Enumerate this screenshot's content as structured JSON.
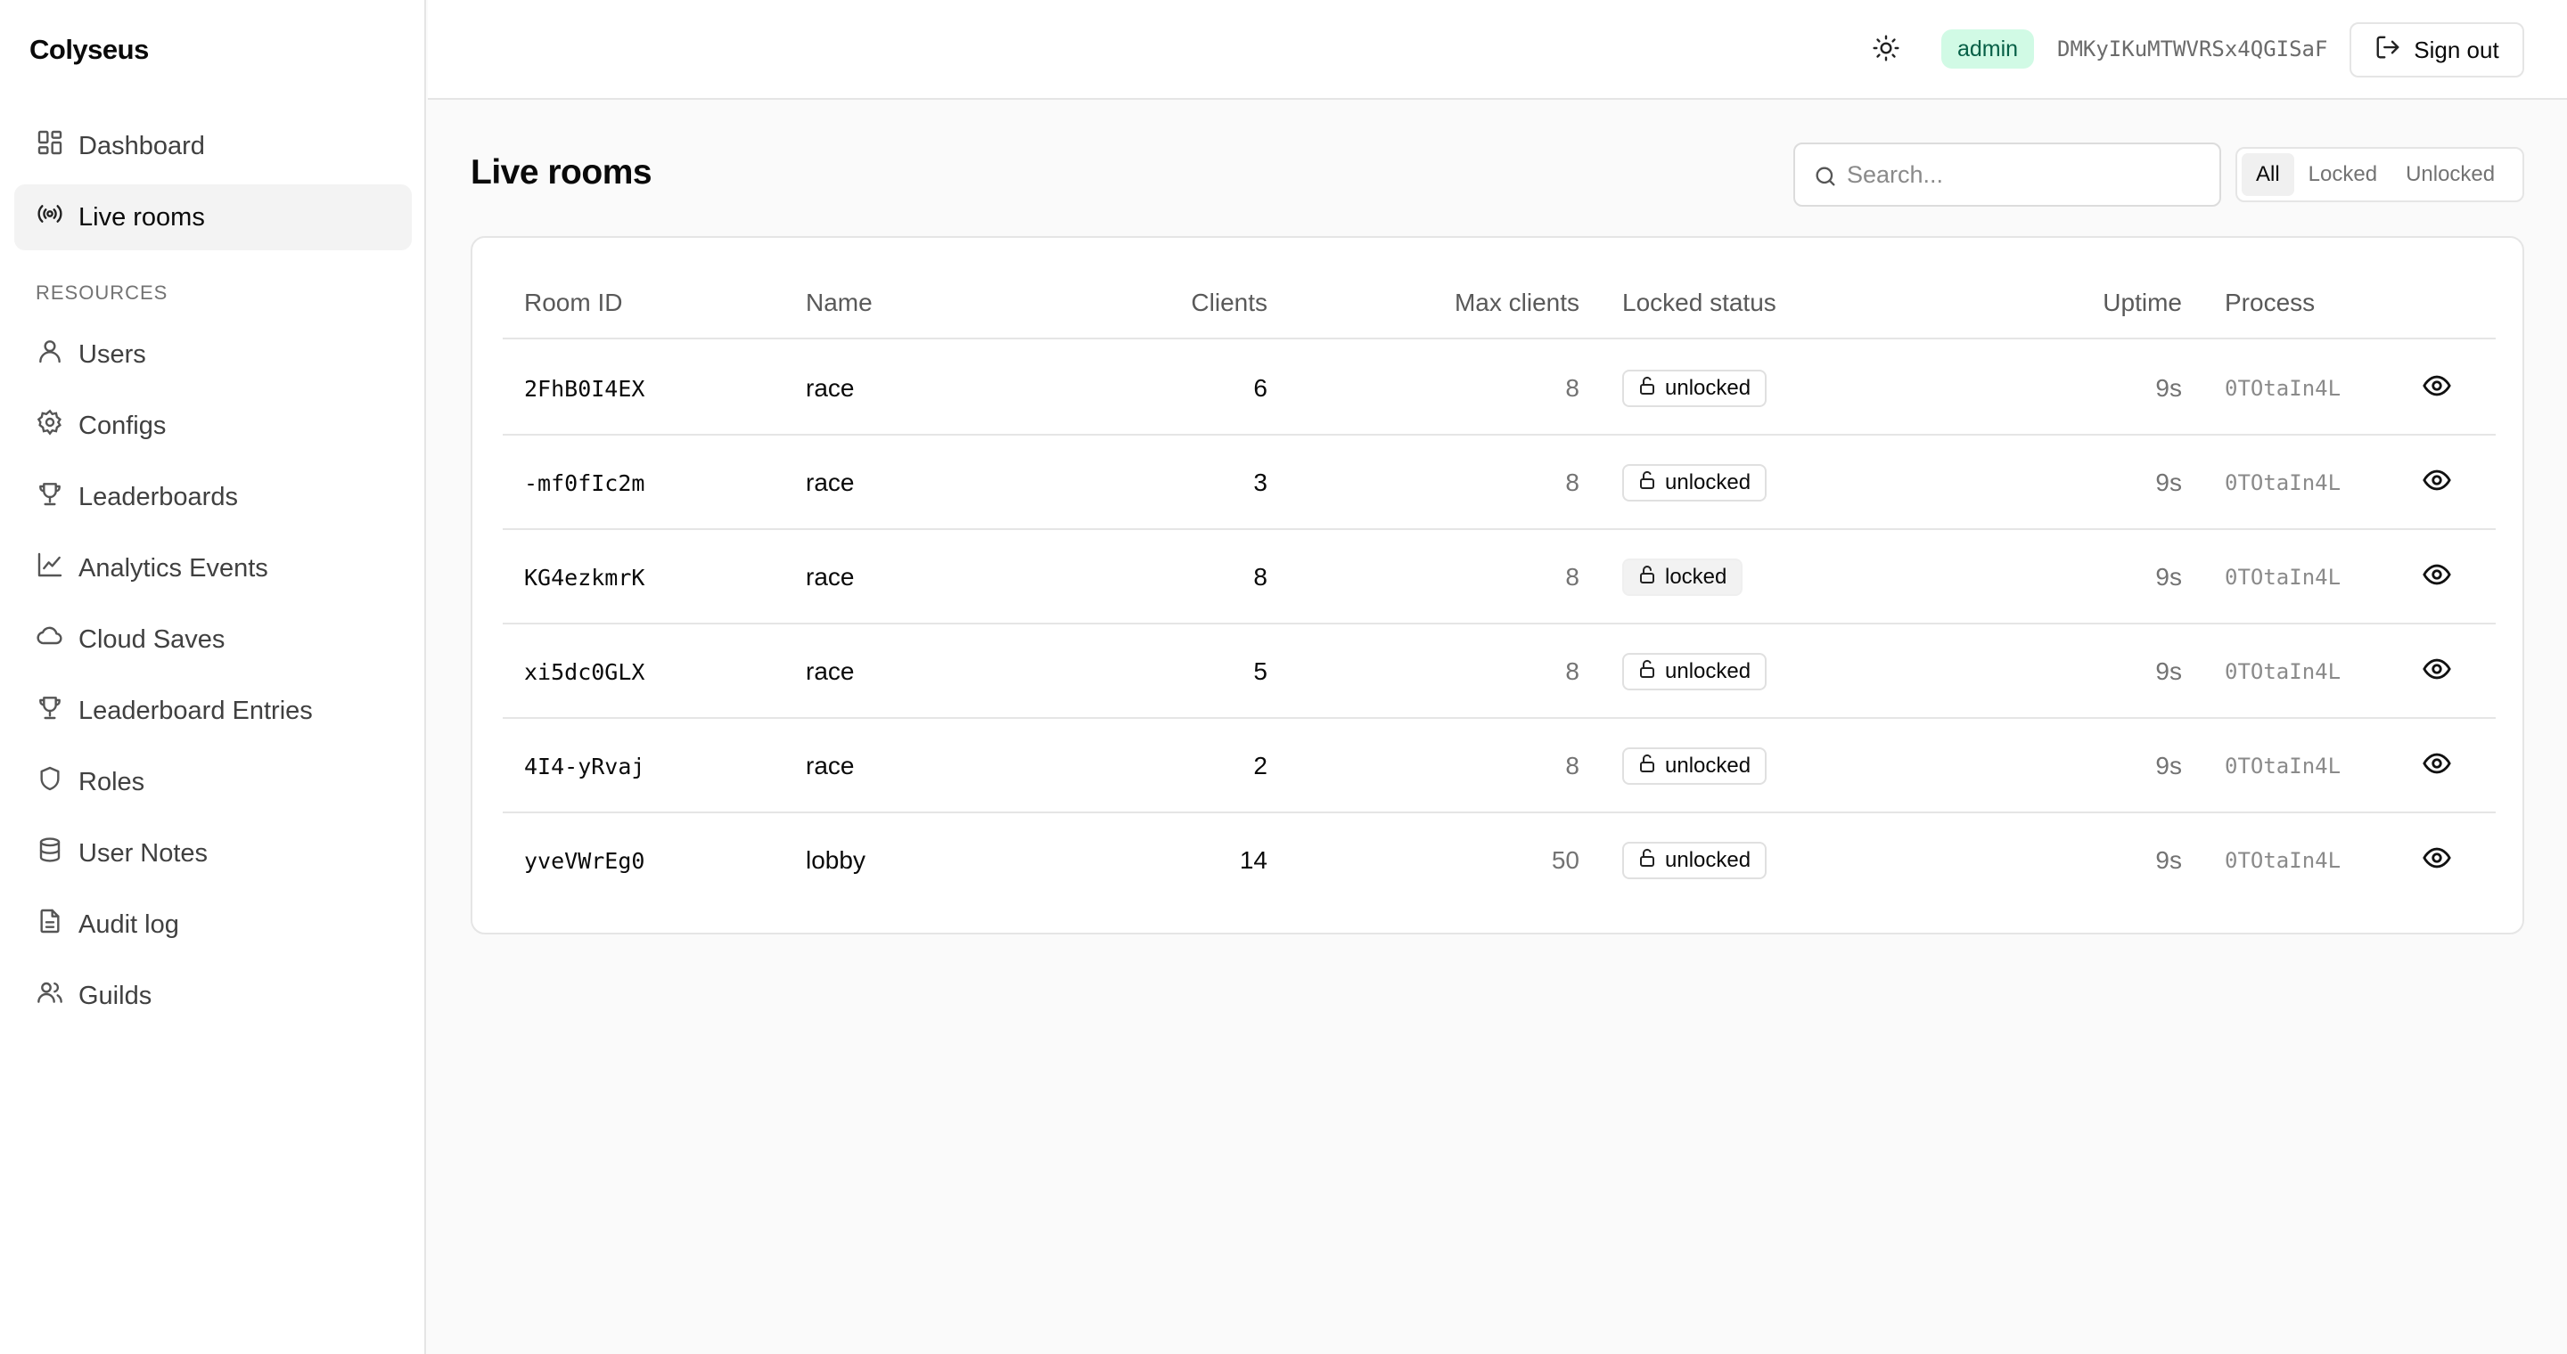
{
  "app": {
    "name": "Colyseus"
  },
  "sidebar": {
    "items": [
      {
        "label": "Dashboard",
        "icon": "dashboard-icon",
        "active": false
      },
      {
        "label": "Live rooms",
        "icon": "broadcast-icon",
        "active": true
      }
    ],
    "section_label": "RESOURCES",
    "resources": [
      {
        "label": "Users",
        "icon": "user-icon"
      },
      {
        "label": "Configs",
        "icon": "gear-icon"
      },
      {
        "label": "Leaderboards",
        "icon": "trophy-icon"
      },
      {
        "label": "Analytics Events",
        "icon": "line-chart-icon"
      },
      {
        "label": "Cloud Saves",
        "icon": "cloud-icon"
      },
      {
        "label": "Leaderboard Entries",
        "icon": "trophy-icon"
      },
      {
        "label": "Roles",
        "icon": "shield-icon"
      },
      {
        "label": "User Notes",
        "icon": "database-icon"
      },
      {
        "label": "Audit log",
        "icon": "document-icon"
      },
      {
        "label": "Guilds",
        "icon": "users-icon"
      }
    ]
  },
  "header": {
    "theme_icon": "sun-icon",
    "role": "admin",
    "user_id": "DMKyIKuMTWVRSx4QGISaF",
    "signout_label": "Sign out"
  },
  "page": {
    "title": "Live rooms",
    "search_placeholder": "Search...",
    "filters": [
      {
        "label": "All",
        "active": true
      },
      {
        "label": "Locked",
        "active": false
      },
      {
        "label": "Unlocked",
        "active": false
      }
    ]
  },
  "table": {
    "columns": {
      "room_id": "Room ID",
      "name": "Name",
      "clients": "Clients",
      "max_clients": "Max clients",
      "locked": "Locked status",
      "uptime": "Uptime",
      "process": "Process"
    },
    "rows": [
      {
        "room_id": "2FhB0I4EX",
        "name": "race",
        "clients": "6",
        "max_clients": "8",
        "locked": "unlocked",
        "uptime": "9s",
        "process": "0TOtaIn4L"
      },
      {
        "room_id": "-mf0fIc2m",
        "name": "race",
        "clients": "3",
        "max_clients": "8",
        "locked": "unlocked",
        "uptime": "9s",
        "process": "0TOtaIn4L"
      },
      {
        "room_id": "KG4ezkmrK",
        "name": "race",
        "clients": "8",
        "max_clients": "8",
        "locked": "locked",
        "uptime": "9s",
        "process": "0TOtaIn4L"
      },
      {
        "room_id": "xi5dc0GLX",
        "name": "race",
        "clients": "5",
        "max_clients": "8",
        "locked": "unlocked",
        "uptime": "9s",
        "process": "0TOtaIn4L"
      },
      {
        "room_id": "4I4-yRvaj",
        "name": "race",
        "clients": "2",
        "max_clients": "8",
        "locked": "unlocked",
        "uptime": "9s",
        "process": "0TOtaIn4L"
      },
      {
        "room_id": "yveVWrEg0",
        "name": "lobby",
        "clients": "14",
        "max_clients": "50",
        "locked": "unlocked",
        "uptime": "9s",
        "process": "0TOtaIn4L"
      }
    ]
  }
}
